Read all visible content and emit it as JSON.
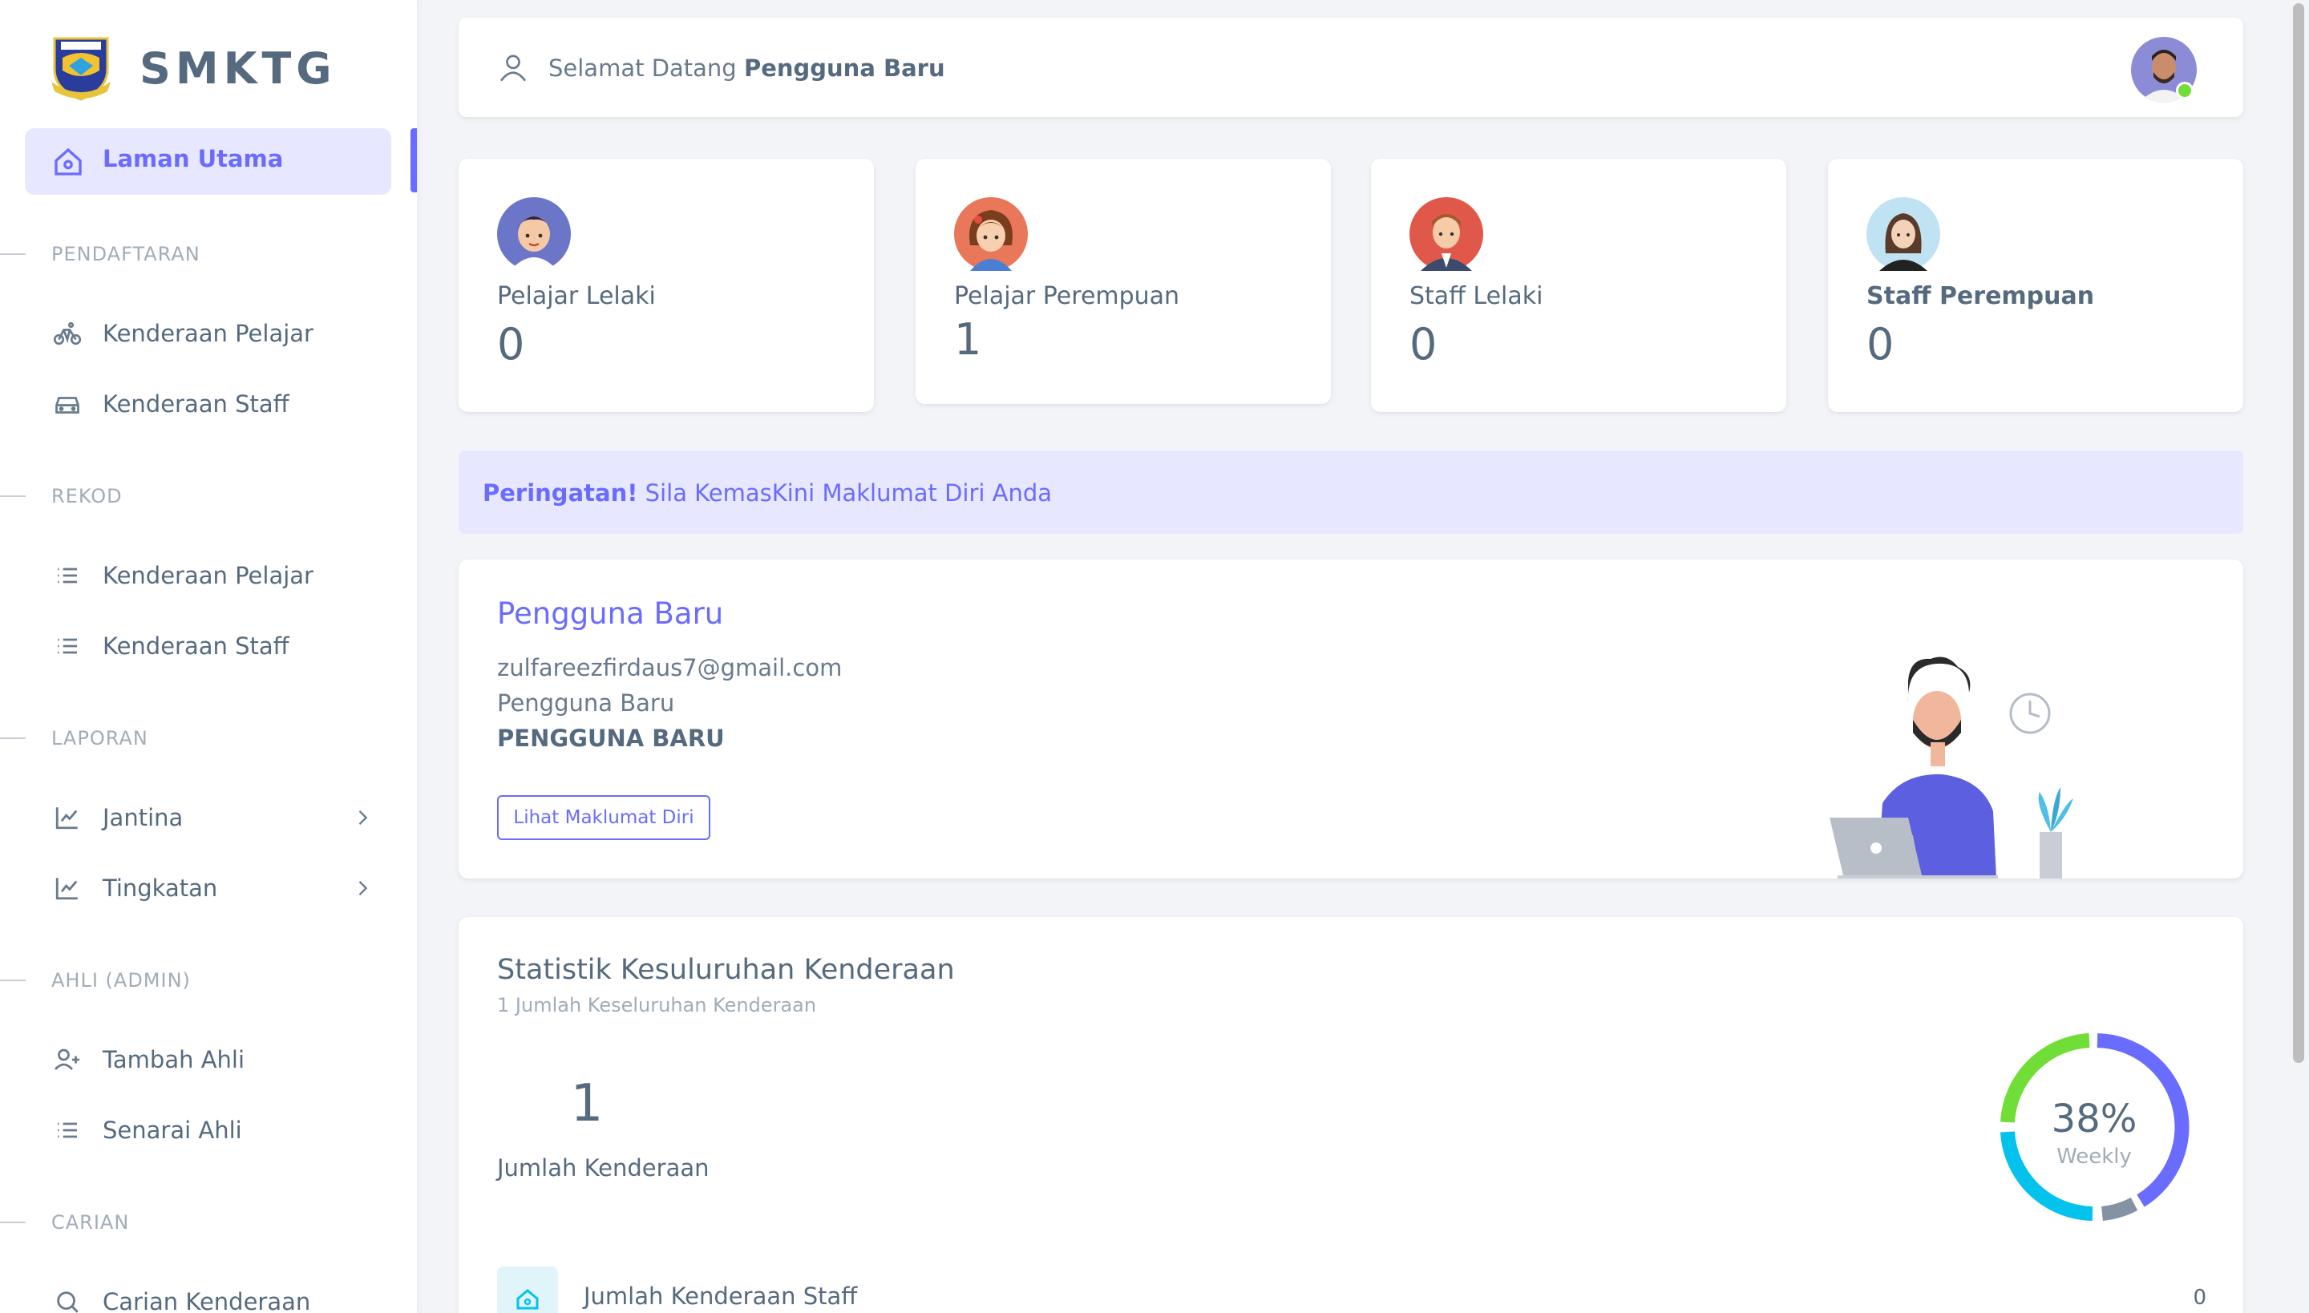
{
  "brand": {
    "name": "SMKTG",
    "logo_icon": "school-crest-icon"
  },
  "sidebar": {
    "active": {
      "label": "Laman Utama",
      "icon": "home-icon"
    },
    "sections": [
      {
        "header": "PENDAFTARAN",
        "items": [
          {
            "label": "Kenderaan Pelajar",
            "icon": "bicycle-icon"
          },
          {
            "label": "Kenderaan Staff",
            "icon": "car-icon"
          }
        ]
      },
      {
        "header": "REKOD",
        "items": [
          {
            "label": "Kenderaan Pelajar",
            "icon": "list-icon"
          },
          {
            "label": "Kenderaan Staff",
            "icon": "list-icon"
          }
        ]
      },
      {
        "header": "LAPORAN",
        "items": [
          {
            "label": "Jantina",
            "icon": "chart-line-icon"
          },
          {
            "label": "Tingkatan",
            "icon": "chart-line-icon"
          }
        ]
      },
      {
        "header": "AHLI (ADMIN)",
        "items": [
          {
            "label": "Tambah Ahli",
            "icon": "user-plus-icon"
          },
          {
            "label": "Senarai Ahli",
            "icon": "list-icon"
          }
        ]
      },
      {
        "header": "CARIAN",
        "items": [
          {
            "label": "Carian Kenderaan",
            "icon": "search-icon"
          }
        ]
      }
    ]
  },
  "navbar": {
    "welcome_prefix": "Selamat Datang",
    "user_name": "Pengguna Baru"
  },
  "stats_cards": [
    {
      "label": "Pelajar Lelaki",
      "value": "0"
    },
    {
      "label": "Pelajar Perempuan",
      "value": "1"
    },
    {
      "label": "Staff Lelaki",
      "value": "0"
    },
    {
      "label": "Staff Perempuan",
      "value": "0"
    }
  ],
  "alert": {
    "strong": "Peringatan!",
    "text": "Sila KemasKini Maklumat Diri Anda"
  },
  "profile": {
    "name": "Pengguna Baru",
    "email": "zulfareezfirdaus7@gmail.com",
    "line2": "Pengguna Baru",
    "line3": "PENGGUNA BARU",
    "button": "Lihat Maklumat Diri"
  },
  "statistics": {
    "title": "Statistik Kesuluruhan Kenderaan",
    "subtitle": "1 Jumlah Keseluruhan Kenderaan",
    "total": "1",
    "total_label": "Jumlah Kenderaan",
    "percent": "38%",
    "period": "Weekly",
    "row_label": "Jumlah Kenderaan Staff",
    "row_value": "0",
    "ring_colors": [
      "#696cff",
      "#8592a3",
      "#03c3ec",
      "#71dd37"
    ]
  }
}
